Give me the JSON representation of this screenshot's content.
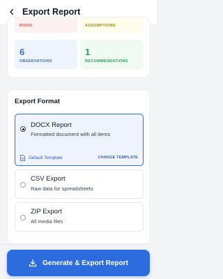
{
  "header": {
    "title": "Export Report",
    "back_icon": "chevron-left-icon"
  },
  "stats": {
    "risks": {
      "label": "RISKS",
      "color": "#d9534f"
    },
    "assumptions": {
      "label": "ASSUMPTIONS",
      "color": "#a08a1a"
    },
    "observations": {
      "value": "6",
      "label": "OBSERVATIONS",
      "color": "#2f6fd6"
    },
    "recommendations": {
      "value": "1",
      "label": "RECOMMENDATIONS",
      "color": "#2e9b57"
    }
  },
  "export": {
    "section_label": "Export Format",
    "options": [
      {
        "name": "DOCX Report",
        "description": "Formatted document with all items",
        "selected": true
      },
      {
        "name": "CSV Export",
        "description": "Raw data for spreadsheets",
        "selected": false
      },
      {
        "name": "ZIP Export",
        "description": "All media files",
        "selected": false
      }
    ],
    "template": {
      "name": "Default Template",
      "change_label": "CHANGE TEMPLATE",
      "icon": "document-icon"
    }
  },
  "action": {
    "label": "Generate & Export Report",
    "icon": "download-icon"
  },
  "colors": {
    "accent": "#2d6cdf",
    "link": "#2f5fb8",
    "selected_bg": "#eef3fd"
  }
}
